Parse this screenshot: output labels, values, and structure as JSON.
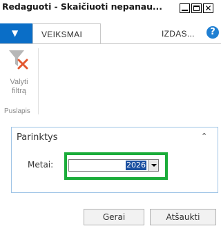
{
  "window": {
    "title": "Redaguoti - Skaičiuoti nepanau...",
    "close_glyph": "✕"
  },
  "tabs": {
    "menu_glyph": "▼",
    "active": "VEIKSMAI",
    "other": "IZDAS...",
    "help_glyph": "?"
  },
  "ribbon": {
    "filter_icon": "clear-filter-icon",
    "filter_label_line1": "Valyti",
    "filter_label_line2": "filtrą",
    "group_label": "Puslapis"
  },
  "fasttab": {
    "title": "Parinktys",
    "collapse_glyph": "⌃",
    "field_label": "Metai:",
    "field_value": "2026"
  },
  "buttons": {
    "ok": "Gerai",
    "cancel": "Atšaukti"
  },
  "colors": {
    "accent": "#0a6ec7",
    "highlight": "#1bac3a",
    "selection": "#1a4fa0"
  }
}
